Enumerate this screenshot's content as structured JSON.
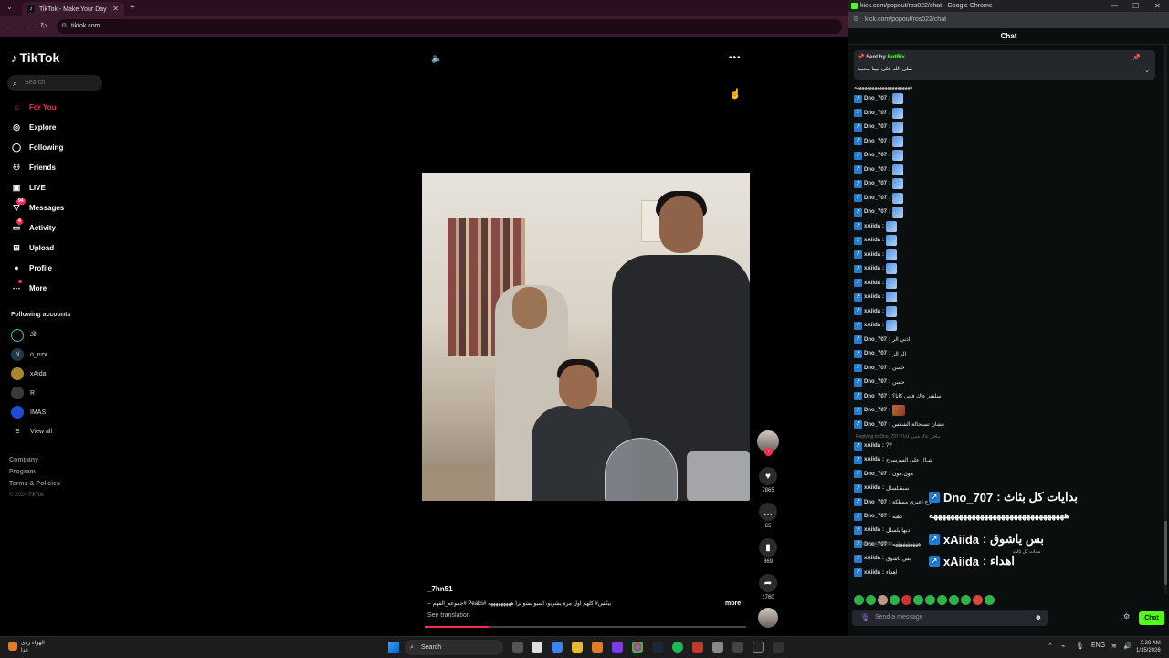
{
  "left_browser": {
    "tab_title": "TikTok - Make Your Day",
    "address": "tiktok.com"
  },
  "tiktok": {
    "logo": "TikTok",
    "search_placeholder": "Search",
    "nav": [
      {
        "label": "For You",
        "icon": "home-icon",
        "active": true
      },
      {
        "label": "Explore",
        "icon": "compass-icon"
      },
      {
        "label": "Following",
        "icon": "following-icon"
      },
      {
        "label": "Friends",
        "icon": "friends-icon"
      },
      {
        "label": "LIVE",
        "icon": "live-icon"
      },
      {
        "label": "Messages",
        "icon": "messages-icon",
        "badge": "94"
      },
      {
        "label": "Activity",
        "icon": "activity-icon",
        "badge": "4"
      },
      {
        "label": "Upload",
        "icon": "upload-icon"
      },
      {
        "label": "Profile",
        "icon": "profile-icon"
      },
      {
        "label": "More",
        "icon": "more-icon"
      }
    ],
    "following_title": "Following accounts",
    "accounts": [
      "𝓡",
      "o_nzx",
      "xAida",
      "R",
      "IMAS"
    ],
    "view_all": "View all",
    "footer": [
      "Company",
      "Program",
      "Terms & Policies"
    ],
    "copyright": "© 2024 TikTok",
    "video": {
      "author": "_7hn51",
      "description": "-- جموعه_القهم# Peaks# بيكس# كلهم اول مرة يشربو، اسيو يسو ترا هههههههههه",
      "more": "more",
      "see_translation": "See translation",
      "progress": 0.2,
      "likes": "7865",
      "comments": "65",
      "saves": "869",
      "shares": "1760"
    }
  },
  "kick": {
    "window_title": "kick.com/popout/ros022/chat - Google Chrome",
    "address": "kick.com/popout/ros022/chat",
    "chat_header": "Chat",
    "pinned": {
      "sent_by": "Sent by",
      "bot": "BotRix",
      "text": "صلى الله على نبينا محمد"
    },
    "messages": [
      {
        "user": "Dno_707",
        "text": ""
      },
      {
        "user": "Dno_707",
        "text": ""
      },
      {
        "user": "Dno_707",
        "text": ""
      },
      {
        "user": "Dno_707",
        "text": ""
      },
      {
        "user": "Dno_707",
        "text": ""
      },
      {
        "user": "Dno_707",
        "text": ""
      },
      {
        "user": "Dno_707",
        "text": ""
      },
      {
        "user": "Dno_707",
        "text": ""
      },
      {
        "user": "Dno_707",
        "text": ""
      },
      {
        "user": "xAiida",
        "text": ""
      },
      {
        "user": "xAiida",
        "text": ""
      },
      {
        "user": "xAiida",
        "text": ""
      },
      {
        "user": "xAiida",
        "text": ""
      },
      {
        "user": "xAiida",
        "text": ""
      },
      {
        "user": "xAiida",
        "text": ""
      },
      {
        "user": "xAiida",
        "text": ""
      },
      {
        "user": "xAiida",
        "text": ""
      },
      {
        "user": "Dno_707",
        "text": "اذني الر"
      },
      {
        "user": "Dno_707",
        "text": "الر الر"
      },
      {
        "user": "Dno_707",
        "text": "حسن"
      },
      {
        "user": "Dno_707",
        "text": "حسن"
      },
      {
        "user": "Dno_707",
        "text": "سلفتر عاك فيني كاتا؟"
      },
      {
        "user": "Dno_707",
        "text": ""
      },
      {
        "user": "Dno_707",
        "text": "عشان تستحالة الشفس"
      }
    ],
    "messages2": [
      {
        "user": "xAiida",
        "text": "??"
      },
      {
        "user": "xAiida",
        "text": "شـال على السرسرح"
      },
      {
        "user": "Dno_707",
        "text": "مون مون"
      },
      {
        "user": "xAiida",
        "text": "سبقـلسال"
      },
      {
        "user": "Dno_707",
        "text": "ارح اعيري مسلكة"
      },
      {
        "user": "Dno_707",
        "text": "دهيه"
      },
      {
        "user": "xAiida",
        "text": "ديها بلسلل"
      },
      {
        "user": "Dno_707",
        "text": "ههههههههههه"
      },
      {
        "user": "xAiida",
        "text": "بس ياشوق"
      },
      {
        "user": "xAiida",
        "text": "اهداء"
      }
    ],
    "reply1": "Replying to Dno_707: مافتر عاك فيني كاتا؟",
    "reply2": "Replying to xAiida: دهيها بلسلل",
    "top_partial": "ههههههههههههههههههههههه",
    "overlay": [
      {
        "user": "Dno_707",
        "text": "بدايات كل بثاث :"
      },
      {
        "user": "",
        "text": "ههههههههههههههههههههههههههههههههه"
      },
      {
        "user": "xAiida",
        "text": "بس ياشوق :"
      },
      {
        "user": "xAiida",
        "text": "اهداء :"
      }
    ],
    "overlay_small": "مابات كل ثالث",
    "input_placeholder": "Send a message",
    "chat_button": "Chat"
  },
  "taskbar": {
    "weather": "الهواء ردئ",
    "weather2": "غدا",
    "search": "Search",
    "lang": "ENG",
    "time": "5:28 AM",
    "date": "1/15/2026"
  },
  "colors": {
    "tiktok_accent": "#fe2c55",
    "kick_green": "#53fc18"
  }
}
